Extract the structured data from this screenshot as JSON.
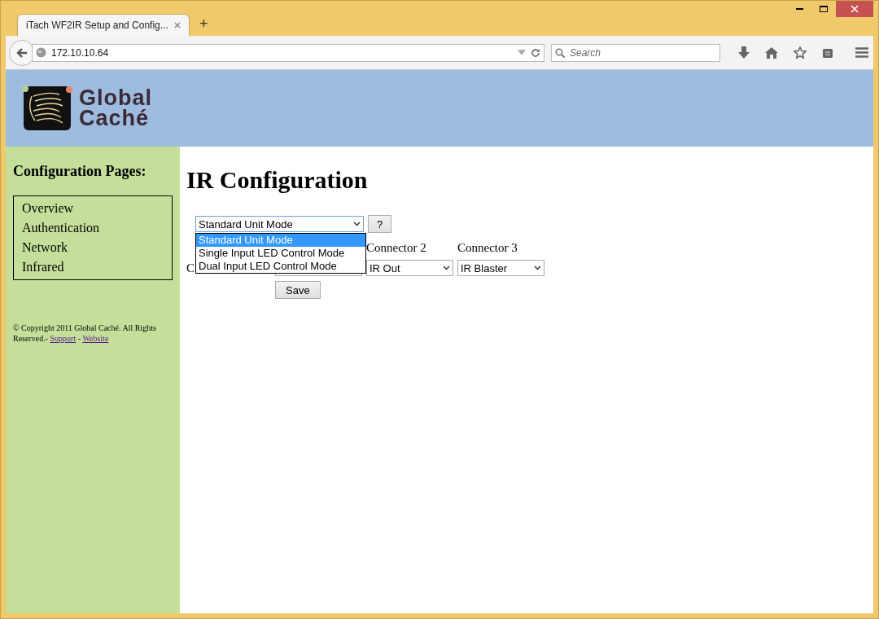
{
  "browser": {
    "tab": {
      "title": "iTach WF2IR Setup and Config...",
      "selected": true
    },
    "new_tab": "+",
    "url": "172.10.10.64",
    "search": {
      "placeholder": "Search"
    }
  },
  "header": {
    "logo": [
      "Global",
      "Caché"
    ]
  },
  "sidebar": {
    "title": "Configuration Pages:",
    "items": [
      "Overview",
      "Authentication",
      "Network",
      "Infrared"
    ],
    "footer": {
      "text": "© Copyright 2011 Global Caché. All Rights Reserved.- ",
      "links": [
        "Support",
        "Website"
      ],
      "separator": " - "
    }
  },
  "main": {
    "title": "IR Configuration",
    "mode_select": {
      "value": "Standard Unit Mode",
      "expanded": true,
      "options": [
        {
          "label": "Standard Unit Mode",
          "selected": true
        },
        {
          "label": "Single Input LED Control Mode",
          "selected": false
        },
        {
          "label": "Dual Input LED Control Mode",
          "selected": false
        }
      ]
    },
    "help_button": "?",
    "columns": [
      "Connector 2",
      "Connector 3"
    ],
    "row_label": "C",
    "selects": [
      "IR Out",
      "IR Blaster"
    ],
    "save_button": "Save"
  }
}
